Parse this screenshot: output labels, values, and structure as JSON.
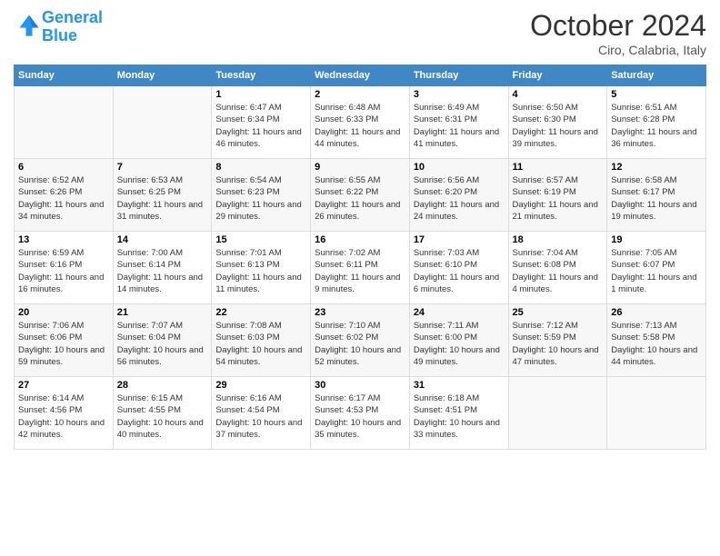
{
  "logo": {
    "text_general": "General",
    "text_blue": "Blue"
  },
  "title": "October 2024",
  "subtitle": "Ciro, Calabria, Italy",
  "days_of_week": [
    "Sunday",
    "Monday",
    "Tuesday",
    "Wednesday",
    "Thursday",
    "Friday",
    "Saturday"
  ],
  "weeks": [
    [
      {
        "day": "",
        "sunrise": "",
        "sunset": "",
        "daylight": ""
      },
      {
        "day": "",
        "sunrise": "",
        "sunset": "",
        "daylight": ""
      },
      {
        "day": "1",
        "sunrise": "Sunrise: 6:47 AM",
        "sunset": "Sunset: 6:34 PM",
        "daylight": "Daylight: 11 hours and 46 minutes."
      },
      {
        "day": "2",
        "sunrise": "Sunrise: 6:48 AM",
        "sunset": "Sunset: 6:33 PM",
        "daylight": "Daylight: 11 hours and 44 minutes."
      },
      {
        "day": "3",
        "sunrise": "Sunrise: 6:49 AM",
        "sunset": "Sunset: 6:31 PM",
        "daylight": "Daylight: 11 hours and 41 minutes."
      },
      {
        "day": "4",
        "sunrise": "Sunrise: 6:50 AM",
        "sunset": "Sunset: 6:30 PM",
        "daylight": "Daylight: 11 hours and 39 minutes."
      },
      {
        "day": "5",
        "sunrise": "Sunrise: 6:51 AM",
        "sunset": "Sunset: 6:28 PM",
        "daylight": "Daylight: 11 hours and 36 minutes."
      }
    ],
    [
      {
        "day": "6",
        "sunrise": "Sunrise: 6:52 AM",
        "sunset": "Sunset: 6:26 PM",
        "daylight": "Daylight: 11 hours and 34 minutes."
      },
      {
        "day": "7",
        "sunrise": "Sunrise: 6:53 AM",
        "sunset": "Sunset: 6:25 PM",
        "daylight": "Daylight: 11 hours and 31 minutes."
      },
      {
        "day": "8",
        "sunrise": "Sunrise: 6:54 AM",
        "sunset": "Sunset: 6:23 PM",
        "daylight": "Daylight: 11 hours and 29 minutes."
      },
      {
        "day": "9",
        "sunrise": "Sunrise: 6:55 AM",
        "sunset": "Sunset: 6:22 PM",
        "daylight": "Daylight: 11 hours and 26 minutes."
      },
      {
        "day": "10",
        "sunrise": "Sunrise: 6:56 AM",
        "sunset": "Sunset: 6:20 PM",
        "daylight": "Daylight: 11 hours and 24 minutes."
      },
      {
        "day": "11",
        "sunrise": "Sunrise: 6:57 AM",
        "sunset": "Sunset: 6:19 PM",
        "daylight": "Daylight: 11 hours and 21 minutes."
      },
      {
        "day": "12",
        "sunrise": "Sunrise: 6:58 AM",
        "sunset": "Sunset: 6:17 PM",
        "daylight": "Daylight: 11 hours and 19 minutes."
      }
    ],
    [
      {
        "day": "13",
        "sunrise": "Sunrise: 6:59 AM",
        "sunset": "Sunset: 6:16 PM",
        "daylight": "Daylight: 11 hours and 16 minutes."
      },
      {
        "day": "14",
        "sunrise": "Sunrise: 7:00 AM",
        "sunset": "Sunset: 6:14 PM",
        "daylight": "Daylight: 11 hours and 14 minutes."
      },
      {
        "day": "15",
        "sunrise": "Sunrise: 7:01 AM",
        "sunset": "Sunset: 6:13 PM",
        "daylight": "Daylight: 11 hours and 11 minutes."
      },
      {
        "day": "16",
        "sunrise": "Sunrise: 7:02 AM",
        "sunset": "Sunset: 6:11 PM",
        "daylight": "Daylight: 11 hours and 9 minutes."
      },
      {
        "day": "17",
        "sunrise": "Sunrise: 7:03 AM",
        "sunset": "Sunset: 6:10 PM",
        "daylight": "Daylight: 11 hours and 6 minutes."
      },
      {
        "day": "18",
        "sunrise": "Sunrise: 7:04 AM",
        "sunset": "Sunset: 6:08 PM",
        "daylight": "Daylight: 11 hours and 4 minutes."
      },
      {
        "day": "19",
        "sunrise": "Sunrise: 7:05 AM",
        "sunset": "Sunset: 6:07 PM",
        "daylight": "Daylight: 11 hours and 1 minute."
      }
    ],
    [
      {
        "day": "20",
        "sunrise": "Sunrise: 7:06 AM",
        "sunset": "Sunset: 6:06 PM",
        "daylight": "Daylight: 10 hours and 59 minutes."
      },
      {
        "day": "21",
        "sunrise": "Sunrise: 7:07 AM",
        "sunset": "Sunset: 6:04 PM",
        "daylight": "Daylight: 10 hours and 56 minutes."
      },
      {
        "day": "22",
        "sunrise": "Sunrise: 7:08 AM",
        "sunset": "Sunset: 6:03 PM",
        "daylight": "Daylight: 10 hours and 54 minutes."
      },
      {
        "day": "23",
        "sunrise": "Sunrise: 7:10 AM",
        "sunset": "Sunset: 6:02 PM",
        "daylight": "Daylight: 10 hours and 52 minutes."
      },
      {
        "day": "24",
        "sunrise": "Sunrise: 7:11 AM",
        "sunset": "Sunset: 6:00 PM",
        "daylight": "Daylight: 10 hours and 49 minutes."
      },
      {
        "day": "25",
        "sunrise": "Sunrise: 7:12 AM",
        "sunset": "Sunset: 5:59 PM",
        "daylight": "Daylight: 10 hours and 47 minutes."
      },
      {
        "day": "26",
        "sunrise": "Sunrise: 7:13 AM",
        "sunset": "Sunset: 5:58 PM",
        "daylight": "Daylight: 10 hours and 44 minutes."
      }
    ],
    [
      {
        "day": "27",
        "sunrise": "Sunrise: 6:14 AM",
        "sunset": "Sunset: 4:56 PM",
        "daylight": "Daylight: 10 hours and 42 minutes."
      },
      {
        "day": "28",
        "sunrise": "Sunrise: 6:15 AM",
        "sunset": "Sunset: 4:55 PM",
        "daylight": "Daylight: 10 hours and 40 minutes."
      },
      {
        "day": "29",
        "sunrise": "Sunrise: 6:16 AM",
        "sunset": "Sunset: 4:54 PM",
        "daylight": "Daylight: 10 hours and 37 minutes."
      },
      {
        "day": "30",
        "sunrise": "Sunrise: 6:17 AM",
        "sunset": "Sunset: 4:53 PM",
        "daylight": "Daylight: 10 hours and 35 minutes."
      },
      {
        "day": "31",
        "sunrise": "Sunrise: 6:18 AM",
        "sunset": "Sunset: 4:51 PM",
        "daylight": "Daylight: 10 hours and 33 minutes."
      },
      {
        "day": "",
        "sunrise": "",
        "sunset": "",
        "daylight": ""
      },
      {
        "day": "",
        "sunrise": "",
        "sunset": "",
        "daylight": ""
      }
    ]
  ]
}
